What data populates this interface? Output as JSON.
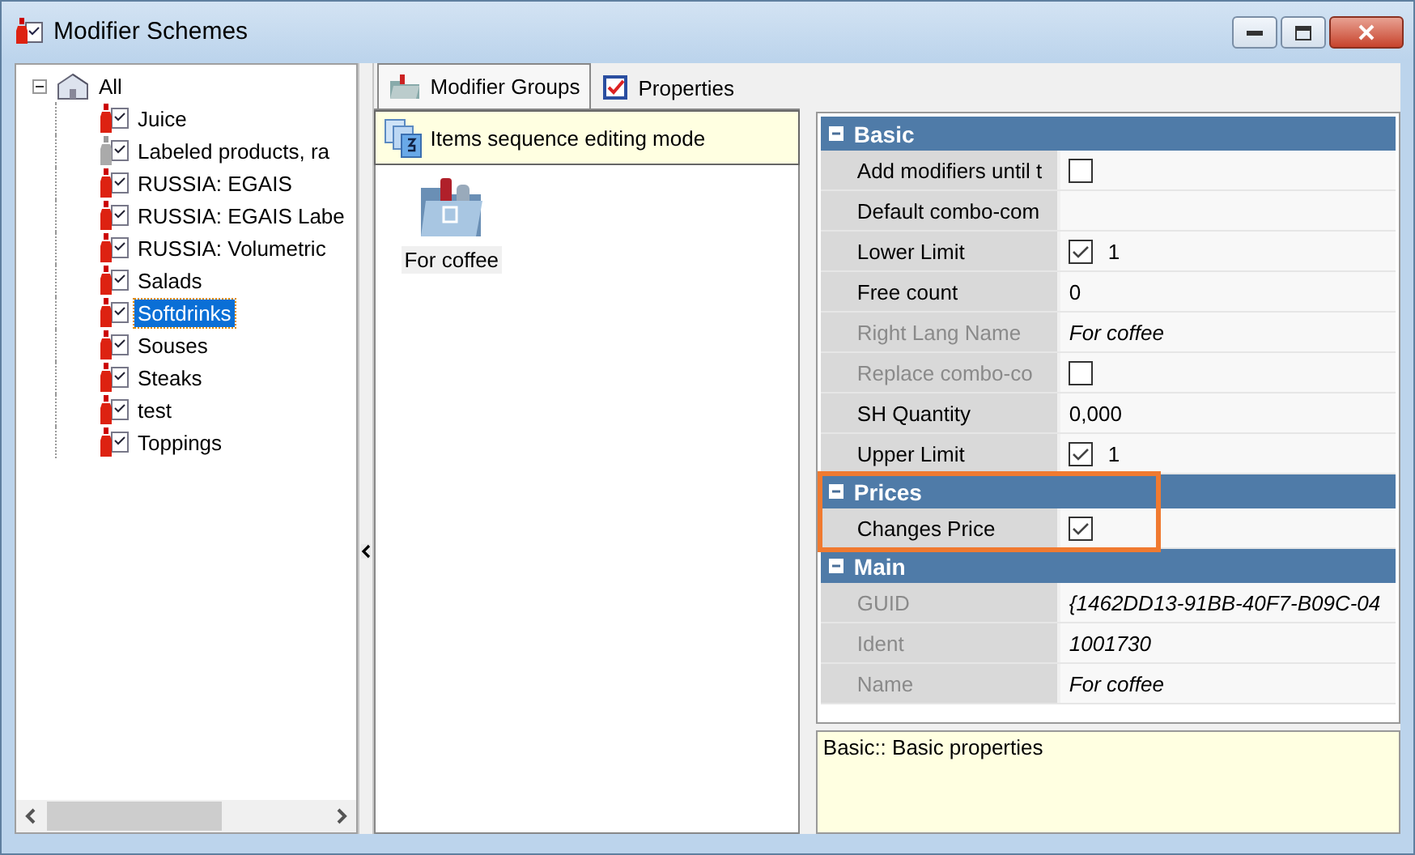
{
  "window": {
    "title": "Modifier Schemes"
  },
  "tree": {
    "root": {
      "label": "All",
      "expanded": true,
      "children": [
        {
          "label": "Juice",
          "selected": false,
          "disabled": false
        },
        {
          "label": "Labeled products, ra",
          "selected": false,
          "disabled": true
        },
        {
          "label": "RUSSIA: EGAIS",
          "selected": false,
          "disabled": false
        },
        {
          "label": "RUSSIA: EGAIS Labe",
          "selected": false,
          "disabled": false
        },
        {
          "label": "RUSSIA: Volumetric",
          "selected": false,
          "disabled": false
        },
        {
          "label": "Salads",
          "selected": false,
          "disabled": false
        },
        {
          "label": "Softdrinks",
          "selected": true,
          "disabled": false
        },
        {
          "label": "Souses",
          "selected": false,
          "disabled": false
        },
        {
          "label": "Steaks",
          "selected": false,
          "disabled": false
        },
        {
          "label": "test",
          "selected": false,
          "disabled": false
        },
        {
          "label": "Toppings",
          "selected": false,
          "disabled": false
        }
      ]
    }
  },
  "tabs": [
    {
      "label": "Modifier Groups",
      "selected": true
    },
    {
      "label": "Properties",
      "selected": false
    }
  ],
  "sequence_bar": {
    "label": "Items sequence editing mode"
  },
  "groups": [
    {
      "label": "For coffee"
    }
  ],
  "property_grid": {
    "categories": [
      {
        "name": "Basic",
        "expanded": true,
        "rows": [
          {
            "name": "Add modifiers until t",
            "disabled": false,
            "kind": "check",
            "checked": false
          },
          {
            "name": "Default combo-com",
            "disabled": false,
            "kind": "text",
            "value": ""
          },
          {
            "name": "Lower Limit",
            "disabled": false,
            "kind": "check",
            "checked": true,
            "value": "1"
          },
          {
            "name": "Free count",
            "disabled": false,
            "kind": "text",
            "value": "0"
          },
          {
            "name": "Right Lang Name",
            "disabled": true,
            "kind": "text",
            "value": "For coffee",
            "italic": true
          },
          {
            "name": "Replace combo-co",
            "disabled": true,
            "kind": "check",
            "checked": false
          },
          {
            "name": "SH Quantity",
            "disabled": false,
            "kind": "text",
            "value": "0,000"
          },
          {
            "name": "Upper Limit",
            "disabled": false,
            "kind": "check",
            "checked": true,
            "value": "1"
          }
        ]
      },
      {
        "name": "Prices",
        "expanded": true,
        "highlighted": true,
        "rows": [
          {
            "name": "Changes Price",
            "disabled": false,
            "kind": "check",
            "checked": true
          }
        ]
      },
      {
        "name": "Main",
        "expanded": true,
        "rows": [
          {
            "name": "GUID",
            "disabled": true,
            "kind": "text",
            "value": "{1462DD13-91BB-40F7-B09C-04",
            "italic": true
          },
          {
            "name": "Ident",
            "disabled": true,
            "kind": "text",
            "value": "1001730",
            "italic": true
          },
          {
            "name": "Name",
            "disabled": true,
            "kind": "text",
            "value": "For coffee",
            "italic": true
          }
        ]
      }
    ]
  },
  "description": {
    "text": "Basic:: Basic properties"
  }
}
